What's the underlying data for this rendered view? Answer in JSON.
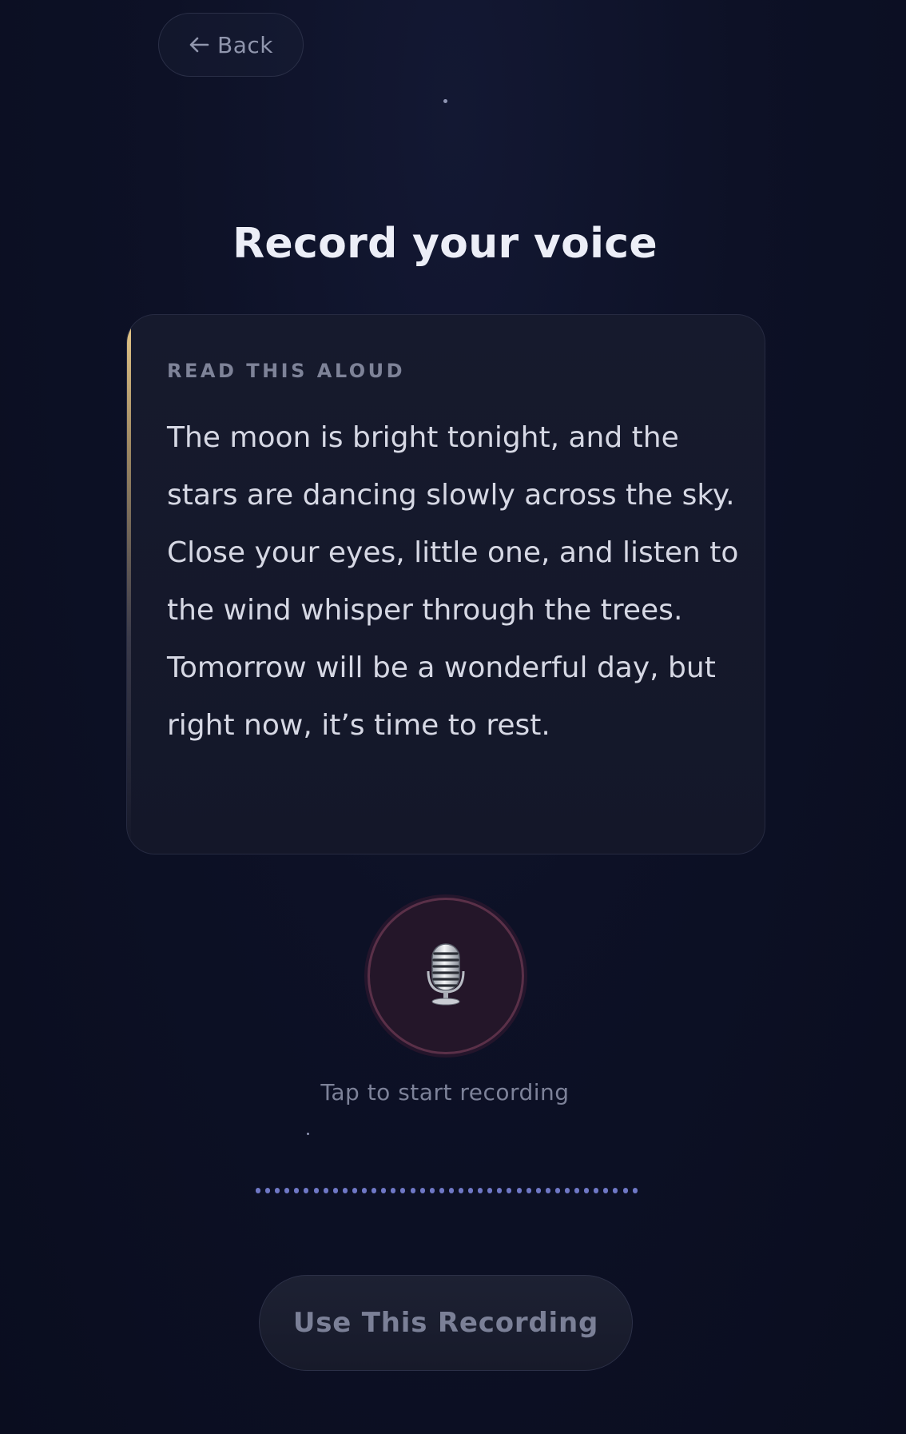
{
  "nav": {
    "back_label": "Back",
    "back_icon": "arrow-left-icon"
  },
  "page": {
    "title": "Record your voice"
  },
  "script_card": {
    "label": "READ THIS ALOUD",
    "text": "The moon is bright tonight, and the stars are dancing slowly across the sky. Close your eyes, little one, and listen to the wind whisper through the trees. Tomorrow will be a wonderful day, but right now, it’s time to rest.",
    "accent_color": "#e8c98a"
  },
  "recorder": {
    "mic_icon": "microphone-icon",
    "hint": "Tap to start recording",
    "waveform_color": "#6f78c6",
    "waveform_dot_count": 40
  },
  "actions": {
    "use_recording_label": "Use This Recording",
    "use_recording_enabled": false
  },
  "colors": {
    "background": "#0a0d1f",
    "mic_ring": "#5a3048",
    "mic_fill": "#241629"
  }
}
